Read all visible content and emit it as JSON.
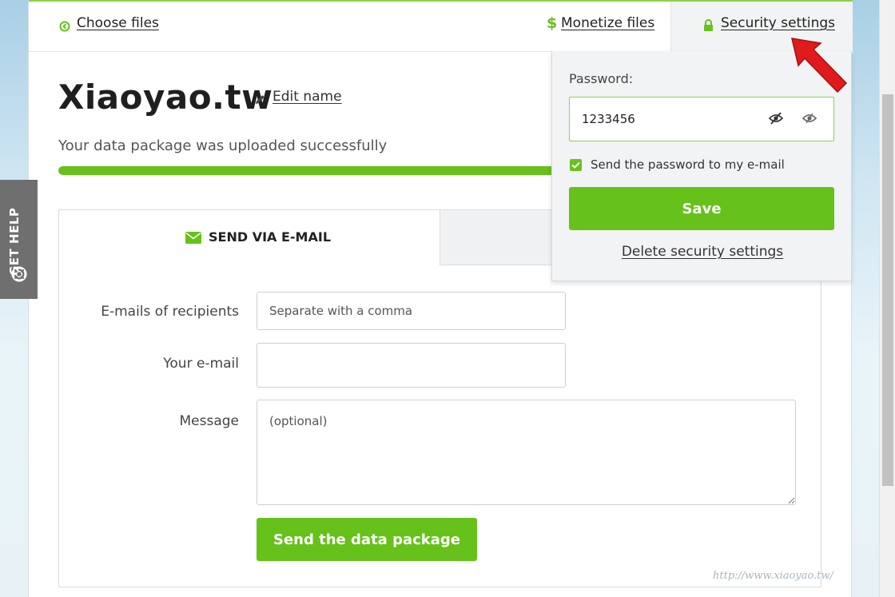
{
  "nav": {
    "choose_files": "Choose files",
    "monetize_files": "Monetize files",
    "security_settings": "Security settings"
  },
  "package": {
    "title": "Xiaoyao.tw",
    "edit_name": "Edit name",
    "upload_status": "Your data package was uploaded successfully",
    "progress_percent": 100
  },
  "tabs": {
    "email_label": "SEND VIA E-MAIL"
  },
  "form": {
    "recipients_label": "E-mails of recipients",
    "recipients_placeholder": "Separate with a comma",
    "your_email_label": "Your e-mail",
    "your_email_value": "",
    "message_label": "Message",
    "message_placeholder": "(optional)",
    "send_button": "Send the data package"
  },
  "side": {
    "get_help": "GET HELP"
  },
  "security": {
    "password_label": "Password:",
    "password_value": "1233456",
    "send_password_label": "Send the password to my e-mail",
    "send_password_checked": true,
    "save_button": "Save",
    "delete_link": "Delete security settings"
  },
  "watermark": "http://www.xiaoyao.tw/",
  "colors": {
    "accent": "#66c21a",
    "accent_light": "#8dd04a",
    "arrow": "#e01b1b"
  },
  "icons": {
    "choose_files": "circle-arrow-left-icon",
    "monetize_files": "dollar-icon",
    "security_settings": "lock-icon",
    "edit_name": "pencil-icon",
    "email_tab": "envelope-icon",
    "get_help": "lifebuoy-icon",
    "password_hidden": "eye-slash-icon",
    "password_visible": "eye-icon"
  }
}
